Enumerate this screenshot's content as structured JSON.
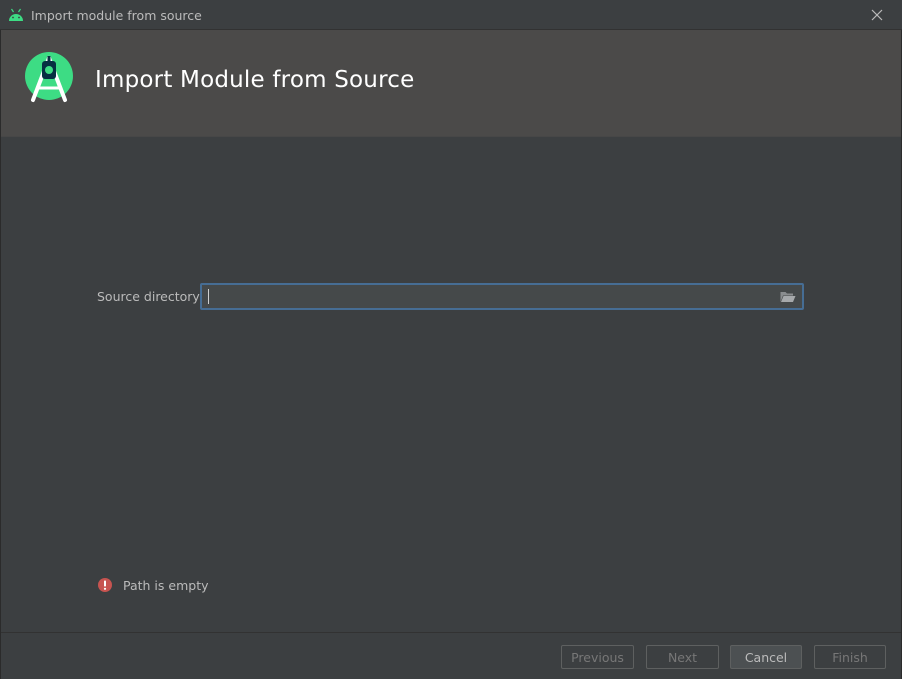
{
  "window": {
    "title": "Import module from source",
    "icon": "android-icon",
    "close_icon": "close-icon"
  },
  "header": {
    "title": "Import Module from Source",
    "logo": "android-studio-logo",
    "background": "#4b4a49"
  },
  "form": {
    "source_label": "Source directory:",
    "source_value": "",
    "browse_icon": "folder-open-icon",
    "focus_color": "#466d94"
  },
  "validation": {
    "message": "Path is empty",
    "icon": "error-icon",
    "color": "#c75450"
  },
  "footer": {
    "previous_label": "Previous",
    "next_label": "Next",
    "cancel_label": "Cancel",
    "finish_label": "Finish"
  },
  "colors": {
    "background": "#3c3f41",
    "android_green": "#3ddc84"
  }
}
